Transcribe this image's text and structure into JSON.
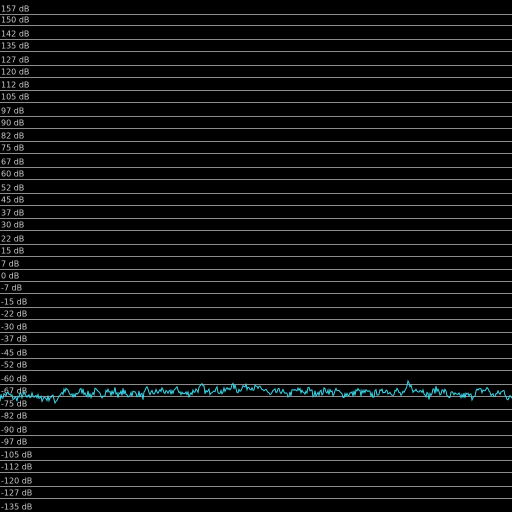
{
  "spectrum": {
    "trace_color": "#3ad6e8",
    "grid_color": "#8c8c8c",
    "label_color": "#c8c8c8",
    "db_scale": {
      "min": -142,
      "max": 162,
      "unit": "dB"
    },
    "gridlines": [
      {
        "value": 157,
        "label": "157 dB"
      },
      {
        "value": 150,
        "label": "150 dB"
      },
      {
        "value": 142,
        "label": "142 dB"
      },
      {
        "value": 135,
        "label": "135 dB"
      },
      {
        "value": 127,
        "label": "127 dB"
      },
      {
        "value": 120,
        "label": "120 dB"
      },
      {
        "value": 112,
        "label": "112 dB"
      },
      {
        "value": 105,
        "label": "105 dB"
      },
      {
        "value": 97,
        "label": "97 dB"
      },
      {
        "value": 90,
        "label": "90 dB"
      },
      {
        "value": 82,
        "label": "82 dB"
      },
      {
        "value": 75,
        "label": "75 dB"
      },
      {
        "value": 67,
        "label": "67 dB"
      },
      {
        "value": 60,
        "label": "60 dB"
      },
      {
        "value": 52,
        "label": "52 dB"
      },
      {
        "value": 45,
        "label": "45 dB"
      },
      {
        "value": 37,
        "label": "37 dB"
      },
      {
        "value": 30,
        "label": "30 dB"
      },
      {
        "value": 22,
        "label": "22 dB"
      },
      {
        "value": 15,
        "label": "15 dB"
      },
      {
        "value": 7,
        "label": "7 dB"
      },
      {
        "value": 0,
        "label": "0 dB"
      },
      {
        "value": -7,
        "label": "-7 dB"
      },
      {
        "value": -15,
        "label": "-15 dB"
      },
      {
        "value": -22,
        "label": "-22 dB"
      },
      {
        "value": -30,
        "label": "-30 dB"
      },
      {
        "value": -37,
        "label": "-37 dB"
      },
      {
        "value": -45,
        "label": "-45 dB"
      },
      {
        "value": -52,
        "label": "-52 dB"
      },
      {
        "value": -60,
        "label": "-60 dB"
      },
      {
        "value": -67,
        "label": "-67 dB"
      },
      {
        "value": -75,
        "label": "-75 dB"
      },
      {
        "value": -82,
        "label": "-82 dB"
      },
      {
        "value": -90,
        "label": "-90 dB"
      },
      {
        "value": -97,
        "label": "-97 dB"
      },
      {
        "value": -105,
        "label": "-105 dB"
      },
      {
        "value": -112,
        "label": "-112 dB"
      },
      {
        "value": -120,
        "label": "-120 dB"
      },
      {
        "value": -127,
        "label": "-127 dB"
      },
      {
        "value": -135,
        "label": "-135 dB"
      }
    ],
    "trace_db": [
      -68.4,
      -66.9,
      -66.0,
      -67.9,
      -69.1,
      -67.4,
      -66.3,
      -68.8,
      -66.8,
      -66.5,
      -69.4,
      -68.1,
      -68.8,
      -67.3,
      -70.5,
      -66.5,
      -65.1,
      -63.7,
      -68.0,
      -66.4,
      -64.4,
      -64.4,
      -66.1,
      -66.8,
      -64.2,
      -66.7,
      -66.3,
      -63.7,
      -66.2,
      -63.7,
      -67.2,
      -64.3,
      -67.3,
      -65.5,
      -65.6,
      -66.0,
      -67.7,
      -63.6,
      -65.9,
      -64.9,
      -65.1,
      -63.0,
      -66.6,
      -65.3,
      -63.5,
      -63.8,
      -66.0,
      -65.9,
      -65.8,
      -64.0,
      -63.4,
      -61.5,
      -65.5,
      -64.5,
      -62.5,
      -64.2,
      -65.0,
      -63.9,
      -61.8,
      -61.8,
      -64.3,
      -61.8,
      -62.0,
      -61.5,
      -62.6,
      -62.6,
      -64.1,
      -63.2,
      -67.2,
      -65.1,
      -64.9,
      -64.0,
      -67.3,
      -66.2,
      -64.5,
      -64.0,
      -64.6,
      -65.0,
      -63.2,
      -66.6,
      -64.6,
      -65.6,
      -63.5,
      -64.7,
      -65.7,
      -64.1,
      -66.5,
      -66.3,
      -65.8,
      -66.3,
      -63.7,
      -65.8,
      -64.9,
      -65.8,
      -66.7,
      -64.9,
      -65.6,
      -63.4,
      -65.0,
      -65.1,
      -64.0,
      -66.5,
      -66.2,
      -58.0,
      -65.0,
      -62.9,
      -63.6,
      -64.7,
      -67.8,
      -65.0,
      -63.2,
      -65.0,
      -64.4,
      -67.6,
      -66.0,
      -67.4,
      -67.4,
      -67.0,
      -66.9,
      -67.8,
      -64.4,
      -64.4,
      -63.9,
      -63.0,
      -67.3,
      -66.3,
      -65.6,
      -64.3,
      -68.9,
      -68.1
    ]
  }
}
